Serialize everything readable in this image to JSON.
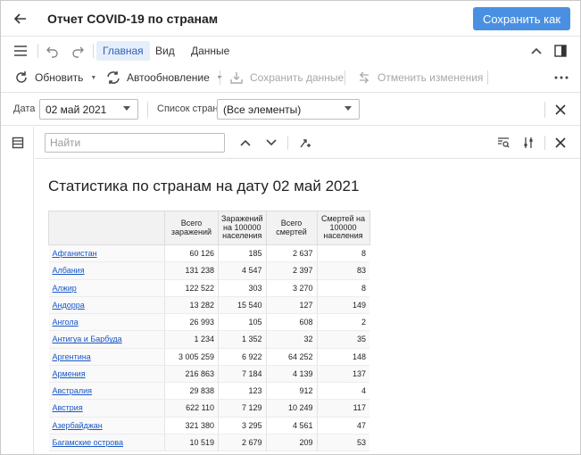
{
  "window": {
    "title": "Отчет COVID-19 по странам",
    "save_as_label": "Сохранить как"
  },
  "ribbon": {
    "tabs": [
      {
        "label": "Главная",
        "active": true
      },
      {
        "label": "Вид",
        "active": false
      },
      {
        "label": "Данные",
        "active": false
      }
    ]
  },
  "toolbar": {
    "refresh_label": "Обновить",
    "autorefresh_label": "Автообновление",
    "save_data_label": "Сохранить данные",
    "cancel_changes_label": "Отменить изменения"
  },
  "params": {
    "date_label": "Дата",
    "date_value": "02 май 2021",
    "countries_label": "Список стран",
    "countries_value": "(Все элементы)"
  },
  "search": {
    "placeholder": "Найти"
  },
  "report": {
    "title": "Статистика по странам на дату 02 май 2021",
    "columns": [
      "Всего заражений",
      "Заражений на 100000 населения",
      "Всего смертей",
      "Смертей на 100000 населения"
    ],
    "rows": [
      {
        "country": "Афганистан",
        "infections": "60 126",
        "infections_per_100k": "185",
        "deaths": "2 637",
        "deaths_per_100k": "8"
      },
      {
        "country": "Албания",
        "infections": "131 238",
        "infections_per_100k": "4 547",
        "deaths": "2 397",
        "deaths_per_100k": "83"
      },
      {
        "country": "Алжир",
        "infections": "122 522",
        "infections_per_100k": "303",
        "deaths": "3 270",
        "deaths_per_100k": "8"
      },
      {
        "country": "Андорра",
        "infections": "13 282",
        "infections_per_100k": "15 540",
        "deaths": "127",
        "deaths_per_100k": "149"
      },
      {
        "country": "Ангола",
        "infections": "26 993",
        "infections_per_100k": "105",
        "deaths": "608",
        "deaths_per_100k": "2"
      },
      {
        "country": "Антигуа и Барбуда",
        "infections": "1 234",
        "infections_per_100k": "1 352",
        "deaths": "32",
        "deaths_per_100k": "35"
      },
      {
        "country": "Аргентина",
        "infections": "3 005 259",
        "infections_per_100k": "6 922",
        "deaths": "64 252",
        "deaths_per_100k": "148"
      },
      {
        "country": "Армения",
        "infections": "216 863",
        "infections_per_100k": "7 184",
        "deaths": "4 139",
        "deaths_per_100k": "137"
      },
      {
        "country": "Австралия",
        "infections": "29 838",
        "infections_per_100k": "123",
        "deaths": "912",
        "deaths_per_100k": "4"
      },
      {
        "country": "Австрия",
        "infections": "622 110",
        "infections_per_100k": "7 129",
        "deaths": "10 249",
        "deaths_per_100k": "117"
      },
      {
        "country": "Азербайджан",
        "infections": "321 380",
        "infections_per_100k": "3 295",
        "deaths": "4 561",
        "deaths_per_100k": "47"
      },
      {
        "country": "Багамские острова",
        "infections": "10 519",
        "infections_per_100k": "2 679",
        "deaths": "209",
        "deaths_per_100k": "53"
      }
    ]
  },
  "icons": {
    "back": "arrow-left-icon",
    "menu": "hamburger-icon",
    "undo": "undo-icon",
    "redo": "redo-icon",
    "collapse": "chevron-up-icon",
    "panel": "side-panel-icon",
    "refresh": "refresh-icon",
    "autorefresh": "auto-refresh-icon",
    "save_data": "save-data-icon",
    "cancel_changes": "cancel-changes-icon",
    "more": "more-dots-icon",
    "close": "close-icon",
    "table_view": "table-view-icon",
    "prev": "chevron-up-icon",
    "next": "chevron-down-icon",
    "replace": "replace-icon",
    "find_settings": "find-in-page-icon",
    "filter_settings": "sliders-icon"
  },
  "colors": {
    "accent": "#4a90e2",
    "active_tab_bg": "#e6eefb",
    "link": "#1a57c8"
  }
}
